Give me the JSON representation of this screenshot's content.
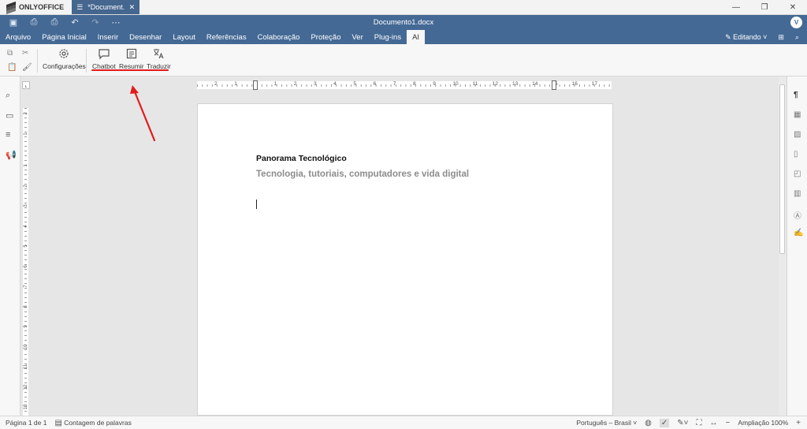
{
  "app": {
    "logo_text": "ONLYOFFICE",
    "tab_title": "*Document...",
    "doc_title": "Documento1.docx",
    "avatar_initial": "V"
  },
  "menu": {
    "tabs": [
      "Arquivo",
      "Página Inicial",
      "Inserir",
      "Desenhar",
      "Layout",
      "Referências",
      "Colaboração",
      "Proteção",
      "Ver",
      "Plug-ins",
      "AI"
    ],
    "active_tab": "AI",
    "mode_label": "Editando"
  },
  "toolbar": {
    "settings_label": "Configurações",
    "chatbot_label": "Chatbot",
    "summarize_label": "Resumir",
    "translate_label": "Traduzir"
  },
  "document": {
    "title": "Panorama Tecnológico",
    "subtitle": "Tecnologia, tutoriais, computadores e vida digital"
  },
  "ruler": {
    "h_ticks": [
      "2",
      "1",
      "1",
      "2",
      "3",
      "4",
      "5",
      "6",
      "7",
      "8",
      "9",
      "10",
      "11",
      "12",
      "13",
      "14",
      "15",
      "16",
      "17"
    ],
    "v_ticks": [
      "2",
      "1",
      "1",
      "2",
      "3",
      "4",
      "5",
      "6",
      "7",
      "8",
      "9",
      "10",
      "11",
      "12",
      "13"
    ]
  },
  "status": {
    "page_info": "Página 1 de 1",
    "word_count_label": "Contagem de palavras",
    "language": "Português – Brasil",
    "zoom": "Ampliação 100%"
  },
  "colors": {
    "header_blue": "#446995",
    "annotation_red": "#e31b1b"
  }
}
